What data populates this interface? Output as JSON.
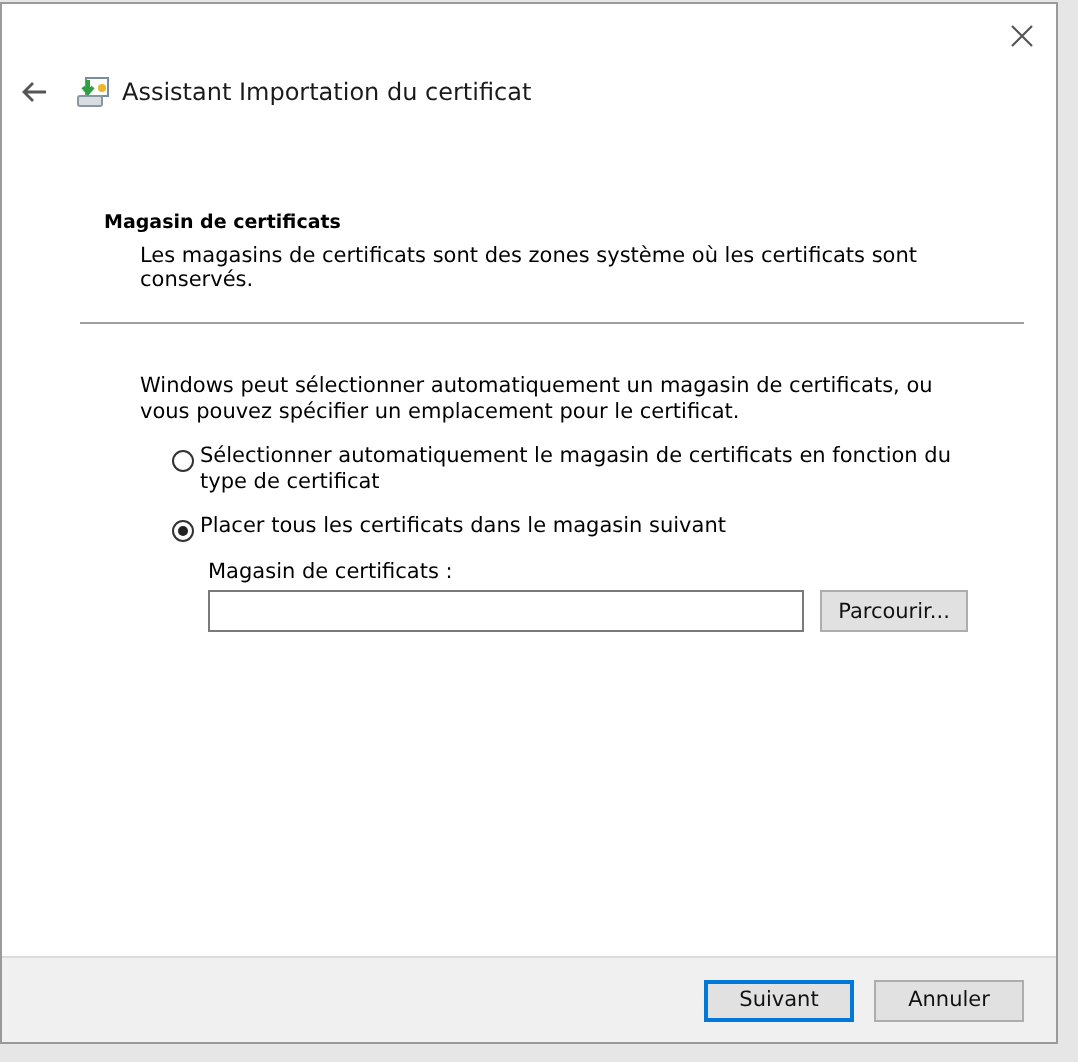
{
  "window": {
    "title": "Assistant Importation du certificat"
  },
  "section": {
    "heading": "Magasin de certificats",
    "description": "Les magasins de certificats sont des zones système où les certificats sont conservés."
  },
  "intro": "Windows peut sélectionner automatiquement un magasin de certificats, ou vous pouvez spécifier un emplacement pour le certificat.",
  "options": [
    {
      "label": "Sélectionner automatiquement le magasin de certificats en fonction du type de certificat",
      "selected": false
    },
    {
      "label": "Placer tous les certificats dans le magasin suivant",
      "selected": true
    }
  ],
  "store_field": {
    "label": "Magasin de certificats :",
    "browse": "Parcourir..."
  },
  "buttons": [
    {
      "label": "Suivant",
      "default": true
    },
    {
      "label": "Annuler",
      "default": false
    }
  ]
}
